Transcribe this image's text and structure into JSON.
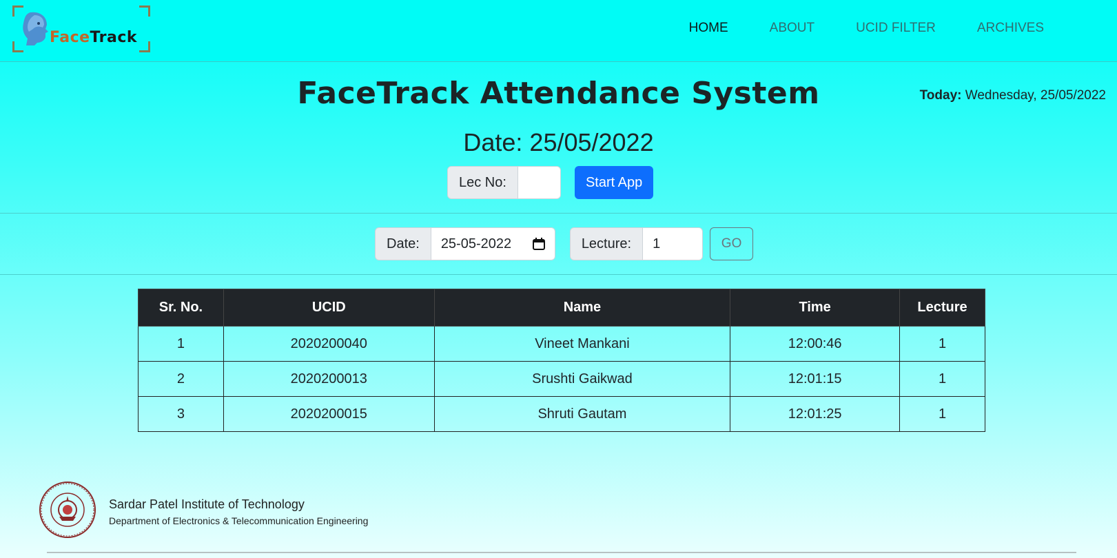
{
  "brand": {
    "logo_text_1": "Face",
    "logo_text_2": "Track"
  },
  "nav": {
    "items": [
      {
        "label": "HOME",
        "active": true
      },
      {
        "label": "ABOUT",
        "active": false
      },
      {
        "label": "UCID FILTER",
        "active": false
      },
      {
        "label": "ARCHIVES",
        "active": false
      }
    ]
  },
  "header": {
    "title": "FaceTrack Attendance System",
    "today_label": "Today:",
    "today_value": "Wednesday, 25/05/2022",
    "date_heading": "Date: 25/05/2022"
  },
  "start_form": {
    "lec_label": "Lec No:",
    "lec_value": "",
    "start_button": "Start App"
  },
  "filter_form": {
    "date_label": "Date:",
    "date_value": "25-05-2022",
    "lecture_label": "Lecture:",
    "lecture_value": "1",
    "go_button": "GO"
  },
  "table": {
    "headers": [
      "Sr. No.",
      "UCID",
      "Name",
      "Time",
      "Lecture"
    ],
    "rows": [
      [
        "1",
        "2020200040",
        "Vineet Mankani",
        "12:00:46",
        "1"
      ],
      [
        "2",
        "2020200013",
        "Srushti Gaikwad",
        "12:01:15",
        "1"
      ],
      [
        "3",
        "2020200015",
        "Shruti Gautam",
        "12:01:25",
        "1"
      ]
    ]
  },
  "footer": {
    "institute": "Sardar Patel Institute of Technology",
    "department": "Department of Electronics & Telecommunication Engineering"
  },
  "colors": {
    "accent": "#0d6efd",
    "nav_bg": "#00fcf6",
    "table_header": "#212529"
  },
  "icons": {
    "logo": "face-track-logo",
    "calendar": "calendar-icon",
    "seal": "institute-seal"
  }
}
